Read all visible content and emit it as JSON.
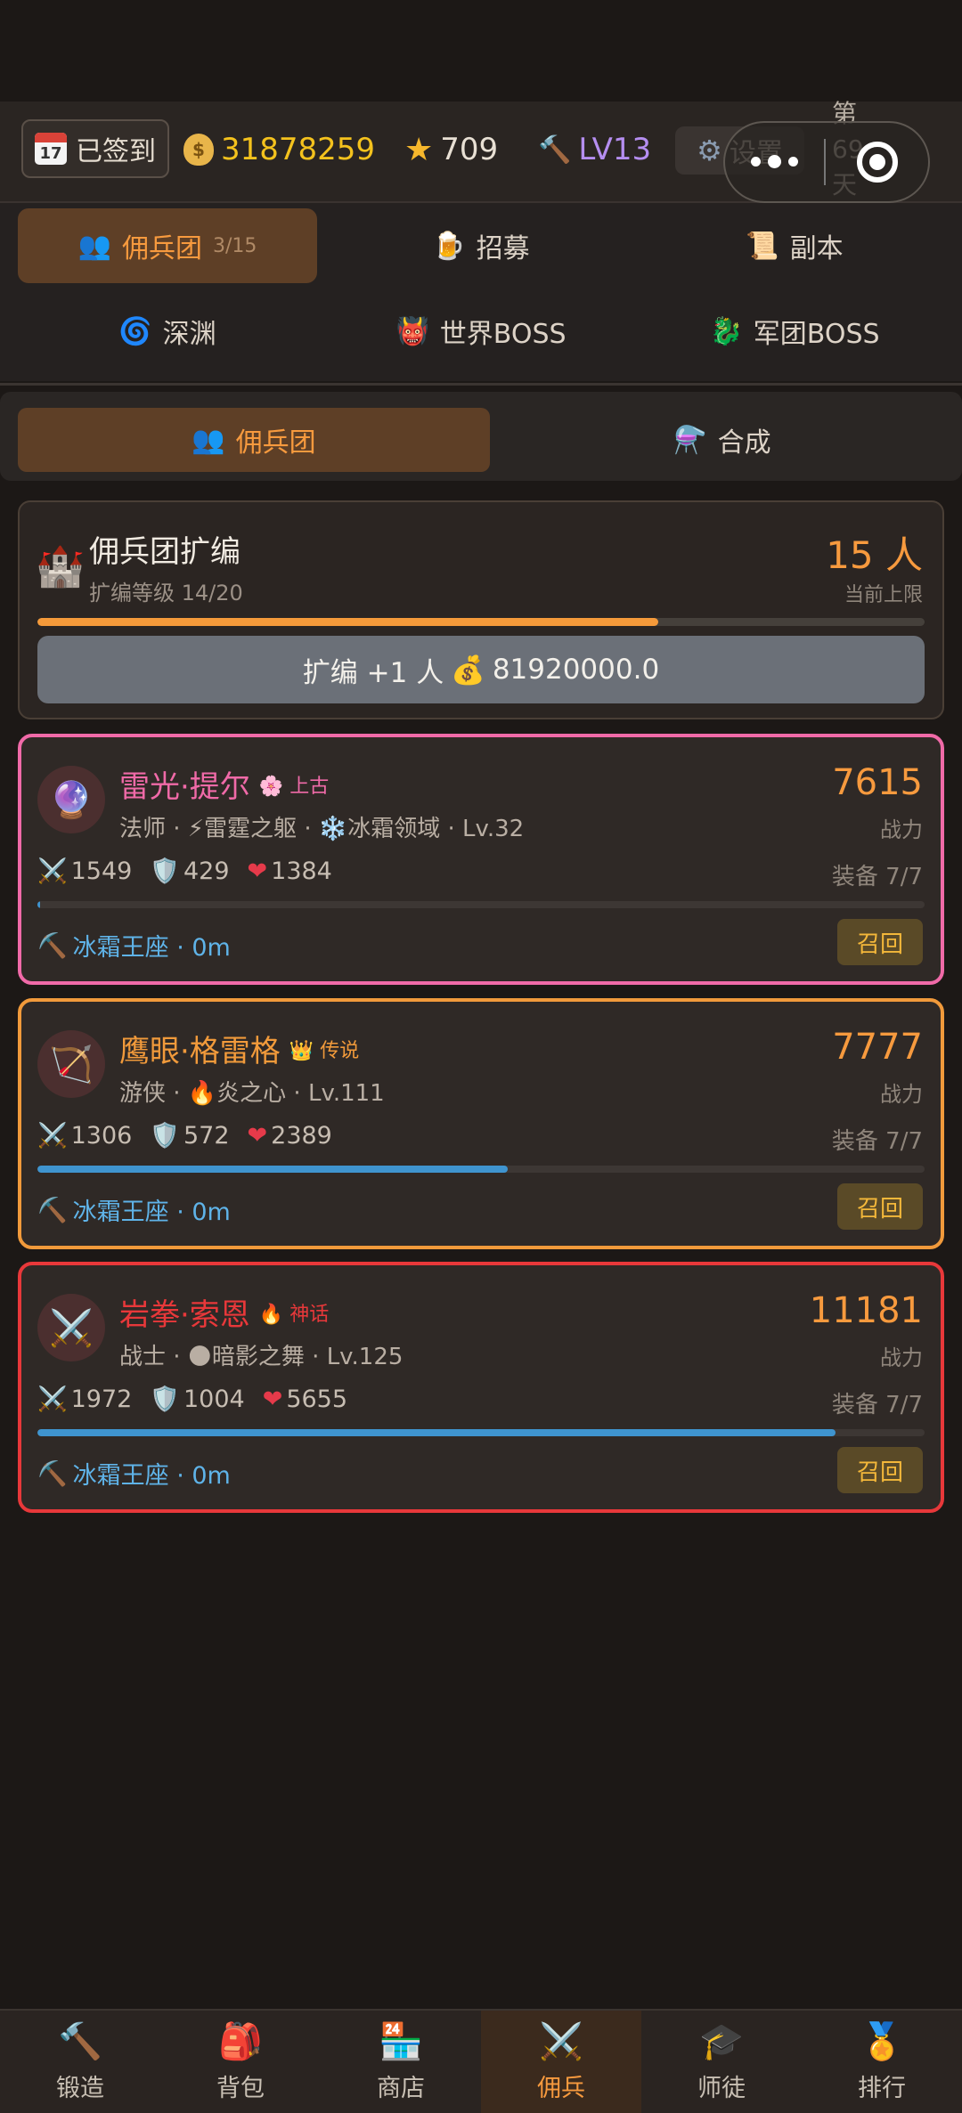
{
  "header": {
    "signin_label": "已签到",
    "calendar_day": "17",
    "gold": "31878259",
    "stars": "709",
    "level": "LV13",
    "settings_label": "设置",
    "day_label": "第\n69\n天"
  },
  "nav": {
    "mercenary": {
      "label": "佣兵团",
      "count": "3/15"
    },
    "recruit": "招募",
    "dungeon": "副本",
    "abyss": "深渊",
    "world_boss": "世界BOSS",
    "legion_boss": "军团BOSS"
  },
  "subtabs": {
    "mercenary": "佣兵团",
    "synthesis": "合成"
  },
  "expand": {
    "title": "佣兵团扩编",
    "level_text": "扩编等级 14/20",
    "level_progress": 0.7,
    "count": "15 人",
    "count_label": "当前上限",
    "button_label": "扩编 +1 人",
    "cost": "81920000.0"
  },
  "mercenaries": [
    {
      "name": "雷光·提尔",
      "rarity_icon": "🌸",
      "rarity": "上古",
      "desc": "法师 · ⚡雷霆之躯 · ❄️冰霜领域 · Lv.32",
      "power": "7615",
      "power_label": "战力",
      "atk": "1549",
      "def": "429",
      "hp": "1384",
      "equip": "装备 7/7",
      "progress": 0.003,
      "location": "冰霜王座 · 0m",
      "recall": "召回",
      "color": "#f06aa8",
      "avatar": "🔮"
    },
    {
      "name": "鹰眼·格雷格",
      "rarity_icon": "👑",
      "rarity": "传说",
      "desc": "游侠 · 🔥炎之心 · Lv.111",
      "power": "7777",
      "power_label": "战力",
      "atk": "1306",
      "def": "572",
      "hp": "2389",
      "equip": "装备 7/7",
      "progress": 0.53,
      "location": "冰霜王座 · 0m",
      "recall": "召回",
      "color": "#f19a3b",
      "avatar": "🏹"
    },
    {
      "name": "岩拳·索恩",
      "rarity_icon": "🔥",
      "rarity": "神话",
      "desc": "战士 · 🌑暗影之舞 · Lv.125",
      "power": "11181",
      "power_label": "战力",
      "atk": "1972",
      "def": "1004",
      "hp": "5655",
      "equip": "装备 7/7",
      "progress": 0.9,
      "location": "冰霜王座 · 0m",
      "recall": "召回",
      "color": "#e8383a",
      "avatar": "⚔️"
    }
  ],
  "bottom_nav": [
    {
      "label": "锻造",
      "icon": "🔨"
    },
    {
      "label": "背包",
      "icon": "🎒"
    },
    {
      "label": "商店",
      "icon": "🏪"
    },
    {
      "label": "佣兵",
      "icon": "⚔️"
    },
    {
      "label": "师徒",
      "icon": "🎓"
    },
    {
      "label": "排行",
      "icon": "🏅"
    }
  ],
  "colors": {
    "accent": "#f79a3e",
    "gold": "#f4c21d",
    "level": "#b58ef0",
    "location": "#5fb3e8"
  }
}
